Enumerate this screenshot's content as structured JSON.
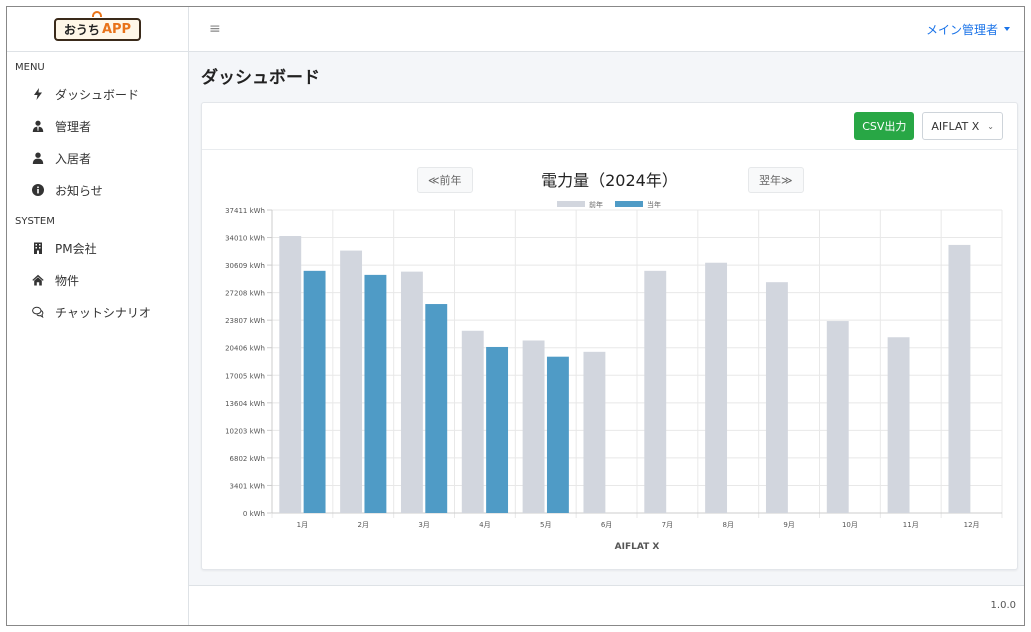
{
  "logo": {
    "text": "おうち",
    "app": "APP"
  },
  "menu": {
    "section1": "MENU",
    "items1": [
      {
        "label": "ダッシュボード",
        "icon": "bolt-icon"
      },
      {
        "label": "管理者",
        "icon": "user-tie-icon"
      },
      {
        "label": "入居者",
        "icon": "user-icon"
      },
      {
        "label": "お知らせ",
        "icon": "info-circle-icon"
      }
    ],
    "section2": "SYSTEM",
    "items2": [
      {
        "label": "PM会社",
        "icon": "building-icon"
      },
      {
        "label": "物件",
        "icon": "home-icon"
      },
      {
        "label": "チャットシナリオ",
        "icon": "chat-icon"
      }
    ]
  },
  "topbar": {
    "user": "メイン管理者"
  },
  "page": {
    "title": "ダッシュボード"
  },
  "card": {
    "csv_label": "CSV出力",
    "property_select": "AIFLAT X",
    "prev_label": "≪前年",
    "next_label": "翌年≫"
  },
  "footer": {
    "version": "1.0.0"
  },
  "chart_data": {
    "type": "bar",
    "title": "電力量（2024年）",
    "xlabel": "AIFLAT X",
    "ylabel": "",
    "categories": [
      "1月",
      "2月",
      "3月",
      "4月",
      "5月",
      "6月",
      "7月",
      "8月",
      "9月",
      "10月",
      "11月",
      "12月"
    ],
    "series": [
      {
        "name": "前年",
        "color": "#d2d6de",
        "values": [
          34200,
          32400,
          29800,
          22500,
          21300,
          19900,
          29900,
          30900,
          28500,
          23700,
          21700,
          33100
        ]
      },
      {
        "name": "当年",
        "color": "#4f9bc6",
        "values": [
          29900,
          29400,
          25800,
          20500,
          19300,
          null,
          null,
          null,
          null,
          null,
          null,
          null
        ]
      }
    ],
    "ylim": [
      0,
      37411
    ],
    "yticks": [
      0,
      3401,
      6802,
      10203,
      13604,
      17005,
      20406,
      23807,
      27208,
      30609,
      34010,
      37411
    ],
    "ytick_labels": [
      "0 kWh",
      "3401 kWh",
      "6802 kWh",
      "10203 kWh",
      "13604 kWh",
      "17005 kWh",
      "20406 kWh",
      "23807 kWh",
      "27208 kWh",
      "30609 kWh",
      "34010 kWh",
      "37411 kWh"
    ],
    "grid": true,
    "legend": "top"
  }
}
